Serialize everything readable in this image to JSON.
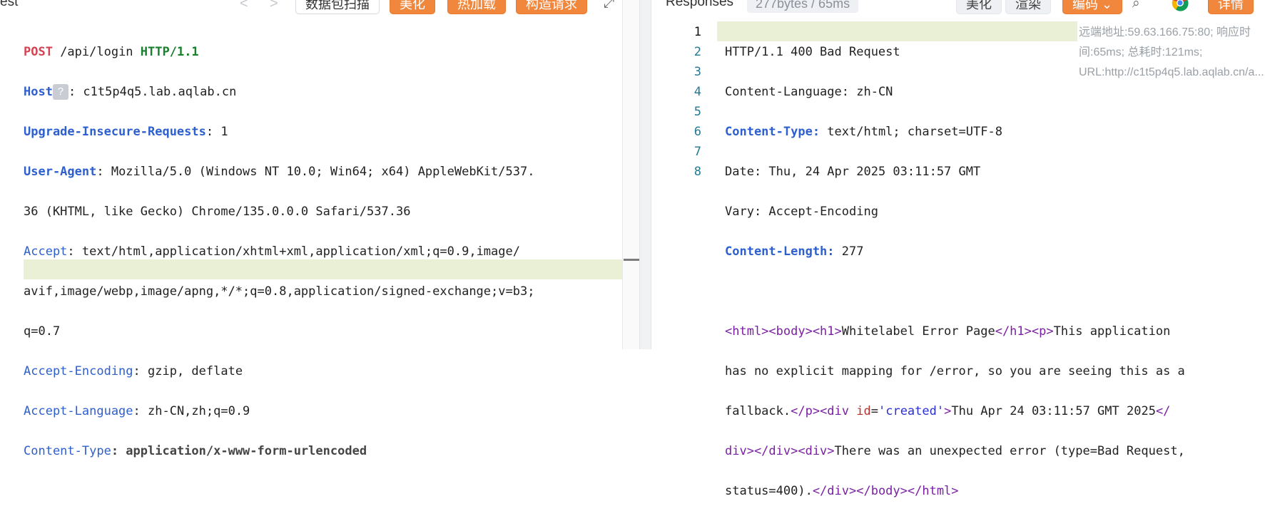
{
  "request": {
    "title_fragment": "est",
    "toolbar": {
      "back_label": "<",
      "forward_label": ">",
      "scan_label": "数据包扫描",
      "beautify_label": "美化",
      "hot_load_label": "热加载",
      "construct_label": "构造请求",
      "expand_label": "⤢"
    },
    "method": "POST",
    "path": " /api/login ",
    "protocol": "HTTP/1.1",
    "host_key": "Host",
    "host_hint": "?",
    "host_value": ": c1t5p4q5.lab.aqlab.cn",
    "uir_key": "Upgrade-Insecure-Requests",
    "uir_value": ": 1",
    "ua_key": "User-Agent",
    "ua_value_1": ": Mozilla/5.0 (Windows NT 10.0; Win64; x64) AppleWebKit/537.",
    "ua_value_2": "36 (KHTML, like Gecko) Chrome/135.0.0.0 Safari/537.36",
    "accept_key": "Accept",
    "accept_value_1": ": text/html,application/xhtml+xml,application/xml;q=0.9,image/",
    "accept_value_2": "avif,image/webp,image/apng,*/*;q=0.8,application/signed-exchange;v=b3;",
    "accept_value_3": "q=0.7",
    "ae_key": "Accept-Encoding",
    "ae_value": ": gzip, deflate",
    "al_key": "Accept-Language",
    "al_value": ": zh-CN,zh;q=0.9",
    "ct_key": "Content-Type",
    "ct_value": ": application/x-www-form-urlencoded"
  },
  "response": {
    "title": "Responses",
    "size_time": "277bytes / 65ms",
    "toolbar": {
      "beautify_label": "美化",
      "render_label": "渲染",
      "encoding_label": "编码 ⌄",
      "details_label": "详情"
    },
    "line_numbers": [
      "1",
      "2",
      "3",
      "4",
      "5",
      "6",
      "7",
      "8"
    ],
    "status_line": "HTTP/1.1 400 Bad Request",
    "cl_key": "Content-Language",
    "cl_value": ": zh-CN",
    "ct_key": "Content-Type:",
    "ct_value": " text/html; charset=UTF-8",
    "date_key": "Date",
    "date_value": ": Thu, 24 Apr 2025 03:11:57 GMT",
    "vary_key": "Vary",
    "vary_value": ": Accept-Encoding",
    "clen_key": "Content-Length:",
    "clen_value": " 277",
    "body_l1_a": "<html><body><h1>",
    "body_l1_b": "Whitelabel Error Page",
    "body_l1_c": "</h1><p>",
    "body_l1_d": "This application",
    "body_l2": "has no explicit mapping for /error, so you are seeing this as a",
    "body_l3_a": "fallback.",
    "body_l3_b": "</p><div ",
    "body_l3_c": "id",
    "body_l3_d": "=",
    "body_l3_e": "'created'",
    "body_l3_f": ">",
    "body_l3_g": "Thu Apr 24 03:11:57 GMT 2025",
    "body_l3_h": "</",
    "body_l4_a": "div></div><div>",
    "body_l4_b": "There was an unexpected error (type=Bad Request,",
    "body_l5_a": "status=400).",
    "body_l5_b": "</div></body></html>",
    "meta_note": "远端地址:59.63.166.75:80; 响应时间:65ms; 总耗时:121ms; URL:http://c1t5p4q5.lab.aqlab.cn/a..."
  }
}
